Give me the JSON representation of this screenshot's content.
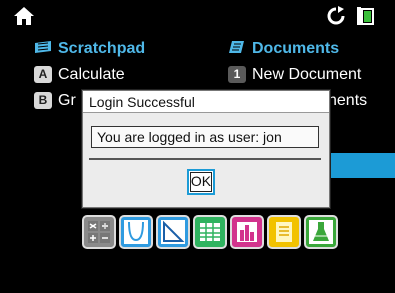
{
  "scratchpad": {
    "title": "Scratchpad",
    "items": [
      {
        "key": "A",
        "label": "Calculate"
      },
      {
        "key": "B",
        "label": "Gr"
      }
    ]
  },
  "documents": {
    "title": "Documents",
    "items": [
      {
        "key": "1",
        "label": "New Document"
      },
      {
        "label": "nents"
      }
    ]
  },
  "dialog": {
    "title": "Login Successful",
    "message": "You are logged in as user: jon",
    "ok_label": "OK"
  },
  "apps": [
    {
      "name": "calculator",
      "color": "#8a8a8a"
    },
    {
      "name": "graphs",
      "color": "#2f9be0"
    },
    {
      "name": "geometry",
      "color": "#2f9be0"
    },
    {
      "name": "lists-spreadsheet",
      "color": "#2fb35f"
    },
    {
      "name": "data-statistics",
      "color": "#d2338d"
    },
    {
      "name": "notes",
      "color": "#f2c200"
    },
    {
      "name": "vernier-dataquest",
      "color": "#3aa73a"
    }
  ],
  "colors": {
    "accent": "#1c9bd6",
    "header": "#4fb8e8"
  }
}
